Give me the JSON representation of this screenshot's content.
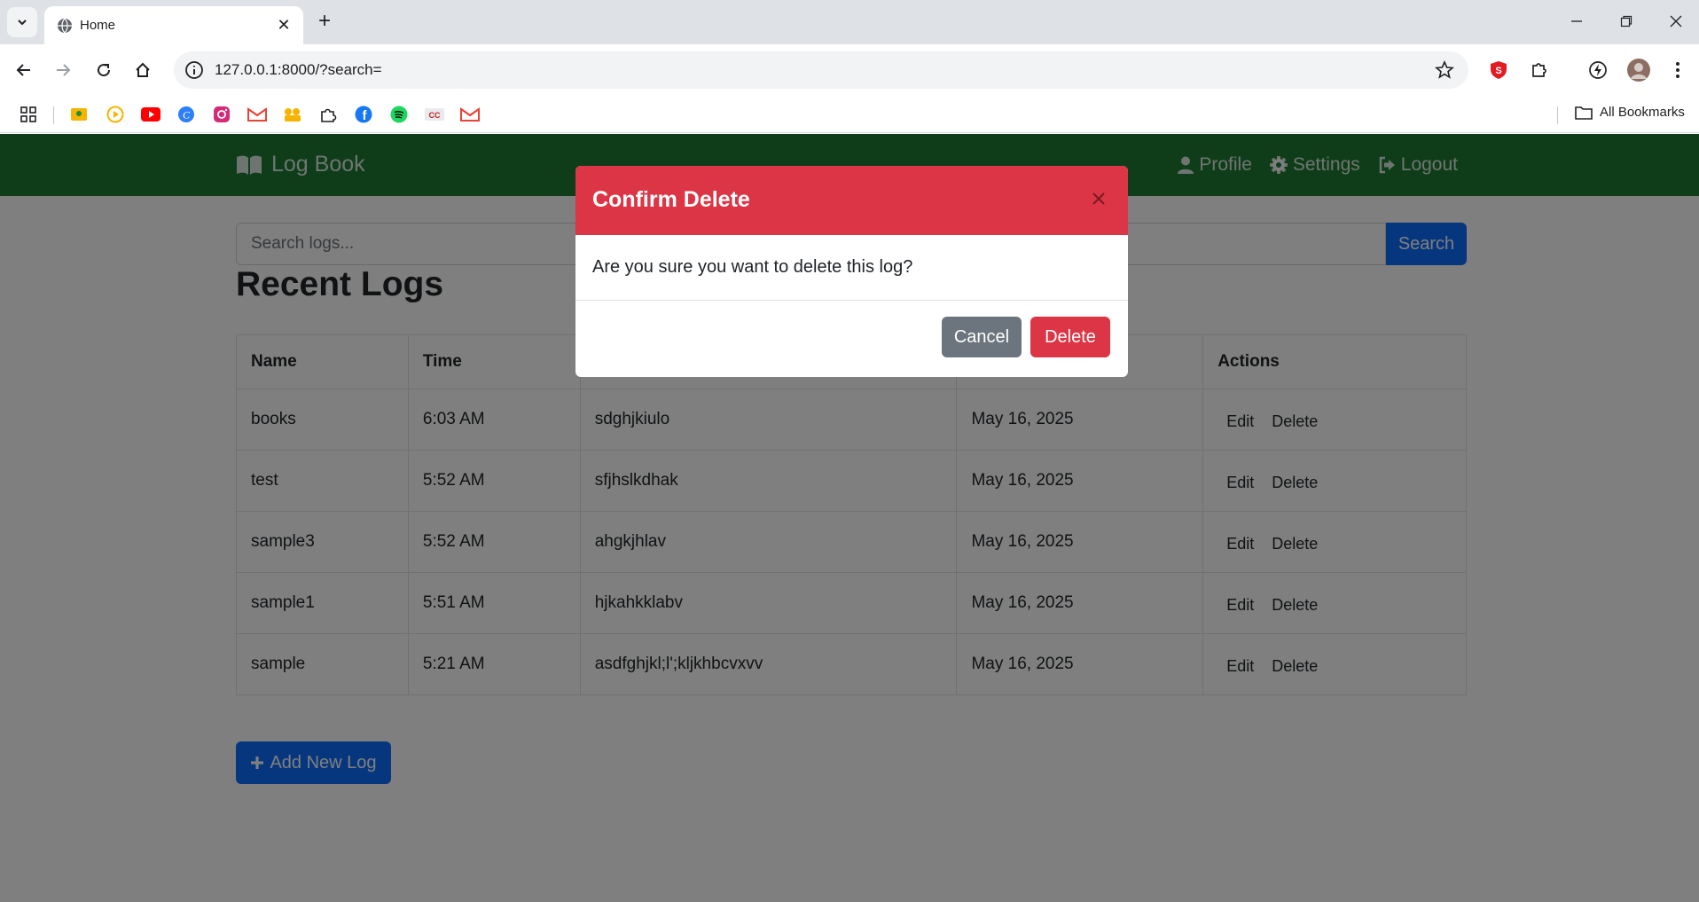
{
  "browser": {
    "tab_title": "Home",
    "url": "127.0.0.1:8000/?search=",
    "all_bookmarks_label": "All Bookmarks",
    "bookmark_icons": [
      "classroom-icon",
      "circle-play-icon",
      "youtube-icon",
      "canva-icon",
      "instagram-icon",
      "gmail-icon",
      "meet-icon",
      "extension-puzzle-icon",
      "facebook-icon",
      "spotify-icon",
      "cc-icon",
      "gmail-icon"
    ]
  },
  "navbar": {
    "brand": "Log Book",
    "links": {
      "profile": "Profile",
      "settings": "Settings",
      "logout": "Logout"
    },
    "color": "#1f7a34"
  },
  "search": {
    "placeholder": "Search logs...",
    "value": "",
    "button_label": "Search"
  },
  "page_title": "Recent Logs",
  "table": {
    "headers": {
      "name": "Name",
      "time": "Time",
      "actions": "Actions"
    },
    "rows": [
      {
        "name": "books",
        "time": "6:03 AM",
        "content": "sdghjkiulo",
        "date": "May 16, 2025",
        "edit": "Edit",
        "delete": "Delete"
      },
      {
        "name": "test",
        "time": "5:52 AM",
        "content": "sfjhslkdhak",
        "date": "May 16, 2025",
        "edit": "Edit",
        "delete": "Delete"
      },
      {
        "name": "sample3",
        "time": "5:52 AM",
        "content": "ahgkjhlav",
        "date": "May 16, 2025",
        "edit": "Edit",
        "delete": "Delete"
      },
      {
        "name": "sample1",
        "time": "5:51 AM",
        "content": "hjkahkklabv",
        "date": "May 16, 2025",
        "edit": "Edit",
        "delete": "Delete"
      },
      {
        "name": "sample",
        "time": "5:21 AM",
        "content": "asdfghjkl;l';kljkhbcvxvv",
        "date": "May 16, 2025",
        "edit": "Edit",
        "delete": "Delete"
      }
    ]
  },
  "add_button": "Add New Log",
  "modal": {
    "title": "Confirm Delete",
    "message": "Are you sure you want to delete this log?",
    "cancel_label": "Cancel",
    "delete_label": "Delete",
    "header_color": "#dc3545"
  }
}
